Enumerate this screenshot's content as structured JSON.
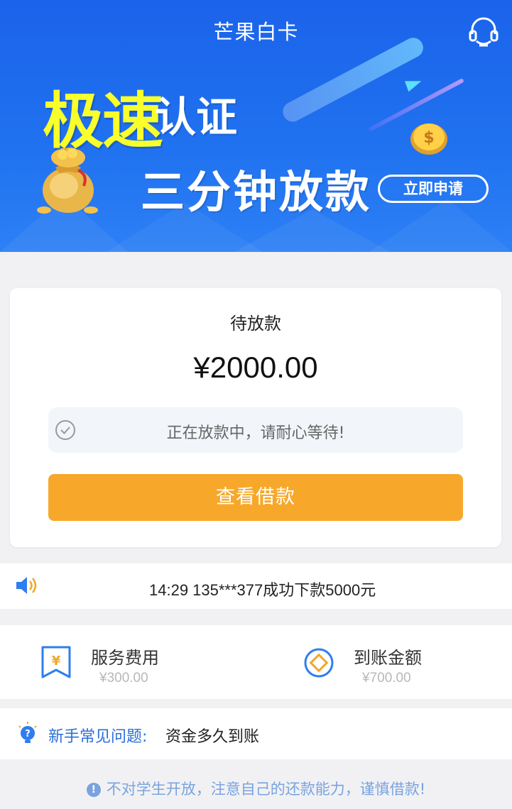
{
  "header": {
    "title": "芒果白卡",
    "support_icon": "headset-icon"
  },
  "banner": {
    "headline_highlight": "极速",
    "headline_rest": "认证",
    "subheadline": "三分钟放款",
    "apply_label": "立即申请",
    "colors": {
      "background": "#2072f0",
      "highlight": "#f8ff2b"
    }
  },
  "loan_card": {
    "status": "待放款",
    "amount": "¥2000.00",
    "notice_text": "正在放款中，请耐心等待!",
    "notice_icon": "check-circle-icon",
    "view_button_label": "查看借款",
    "button_color": "#f7a82a"
  },
  "ticker": {
    "icon": "speaker-icon",
    "text": "14:29 135***377成功下款5000元"
  },
  "fees": [
    {
      "icon": "yen-tag-icon",
      "label": "服务费用",
      "value": "¥300.00"
    },
    {
      "icon": "target-coin-icon",
      "label": "到账金额",
      "value": "¥700.00"
    }
  ],
  "faq": {
    "icon": "lightbulb-icon",
    "label": "新手常见问题:",
    "question": "资金多久到账"
  },
  "footer": {
    "icon": "info-icon",
    "text": "不对学生开放，注意自己的还款能力，谨慎借款!"
  }
}
